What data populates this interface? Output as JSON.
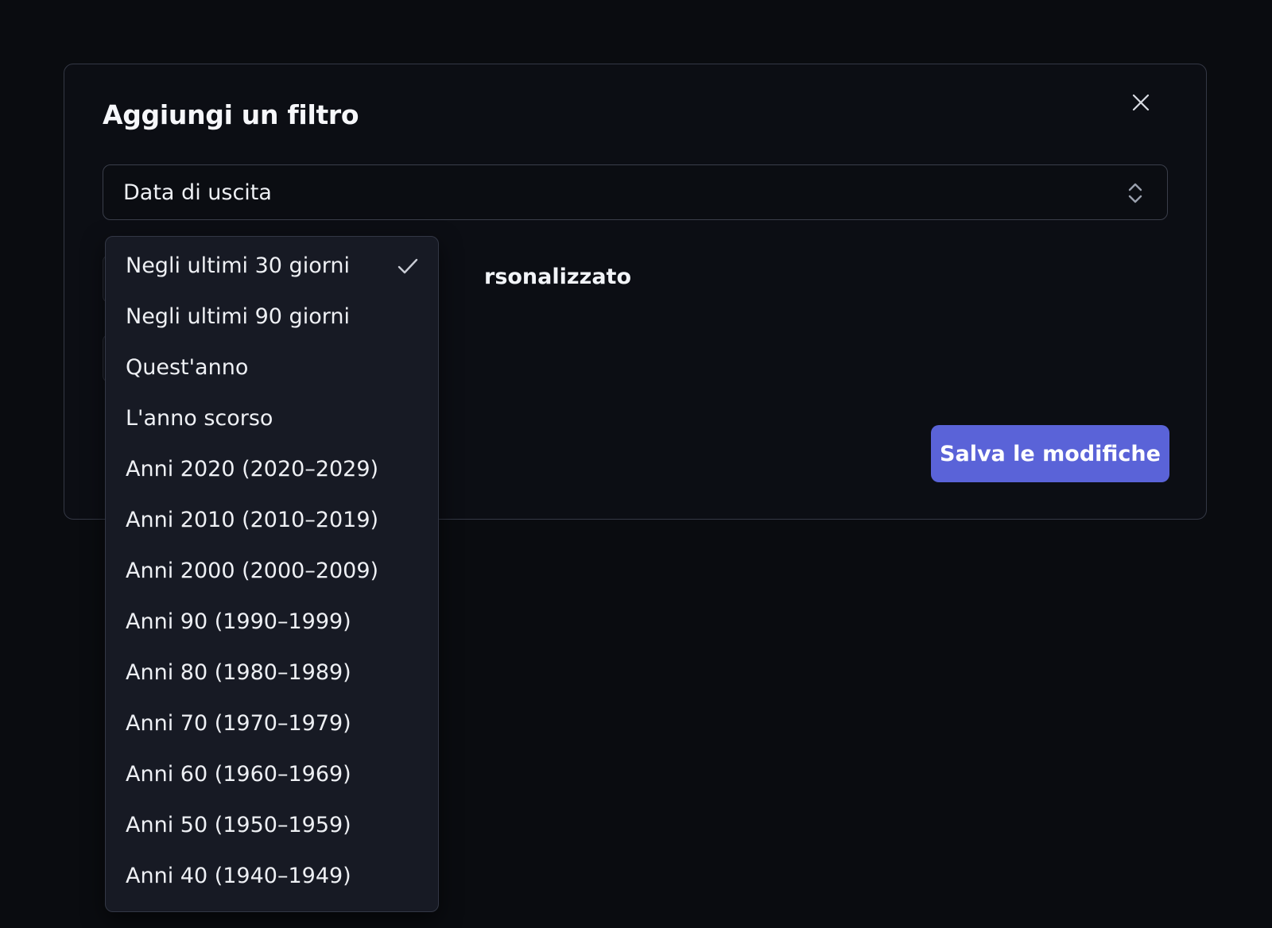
{
  "modal": {
    "title": "Aggiungi un filtro",
    "close_icon": "close-icon",
    "field_select": {
      "value": "Data di uscita",
      "icon": "chevron-up-down-icon"
    },
    "partial_label": "rsonalizzato",
    "save_label": "Salva le modifiche"
  },
  "dropdown": {
    "selected_index": 0,
    "check_icon": "check-icon",
    "options": [
      "Negli ultimi 30 giorni",
      "Negli ultimi 90 giorni",
      "Quest'anno",
      "L'anno scorso",
      "Anni 2020 (2020–2029)",
      "Anni 2010 (2010–2019)",
      "Anni 2000 (2000–2009)",
      "Anni 90 (1990–1999)",
      "Anni 80 (1980–1989)",
      "Anni 70 (1970–1979)",
      "Anni 60 (1960–1969)",
      "Anni 50 (1950–1959)",
      "Anni 40 (1940–1949)"
    ]
  },
  "colors": {
    "background": "#0a0c10",
    "modal_background": "#0c0e14",
    "dropdown_background": "#171a24",
    "accent": "#5a63d8"
  }
}
